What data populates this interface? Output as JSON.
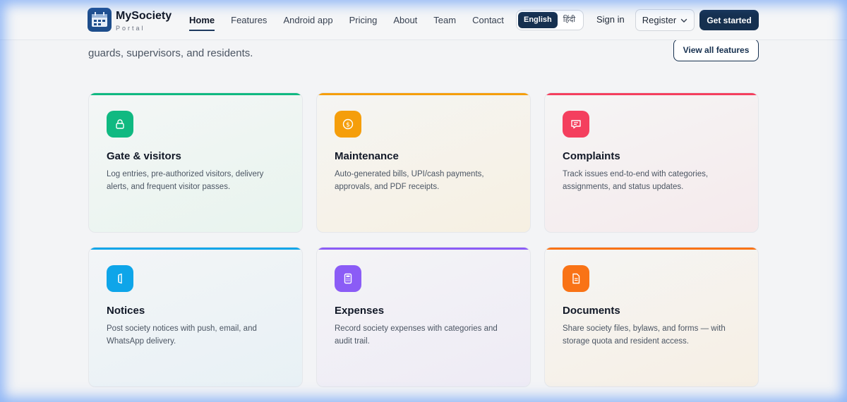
{
  "brand": {
    "name": "MySociety",
    "sub": "Portal"
  },
  "nav": {
    "items": [
      {
        "label": "Home",
        "active": true
      },
      {
        "label": "Features"
      },
      {
        "label": "Android app"
      },
      {
        "label": "Pricing"
      },
      {
        "label": "About"
      },
      {
        "label": "Team"
      },
      {
        "label": "Contact"
      }
    ],
    "lang": {
      "english": "English",
      "hindi": "हिंदी"
    },
    "signin": "Sign in",
    "register": "Register",
    "get_started": "Get started"
  },
  "intro": {
    "line1_partial": "",
    "line2": "guards, supervisors, and residents.",
    "view_all": "View all features"
  },
  "colors": {
    "green": "#10b981",
    "amber": "#f59e0b",
    "rose": "#f43f5e",
    "sky": "#0ea5e9",
    "violet": "#8b5cf6",
    "orange": "#f97316",
    "navy": "#16304f"
  },
  "cards": [
    {
      "title": "Gate & visitors",
      "desc": "Log entries, pre-authorized visitors, delivery alerts, and frequent visitor passes.",
      "icon": "lock-icon"
    },
    {
      "title": "Maintenance",
      "desc": "Auto-generated bills, UPI/cash payments, approvals, and PDF receipts.",
      "icon": "dollar-icon"
    },
    {
      "title": "Complaints",
      "desc": "Track issues end-to-end with categories, assignments, and status updates.",
      "icon": "message-icon"
    },
    {
      "title": "Notices",
      "desc": "Post society notices with push, email, and WhatsApp delivery.",
      "icon": "megaphone-icon"
    },
    {
      "title": "Expenses",
      "desc": "Record society expenses with categories and audit trail.",
      "icon": "calculator-icon"
    },
    {
      "title": "Documents",
      "desc": "Share society files, bylaws, and forms — with storage quota and resident access.",
      "icon": "document-icon"
    }
  ]
}
